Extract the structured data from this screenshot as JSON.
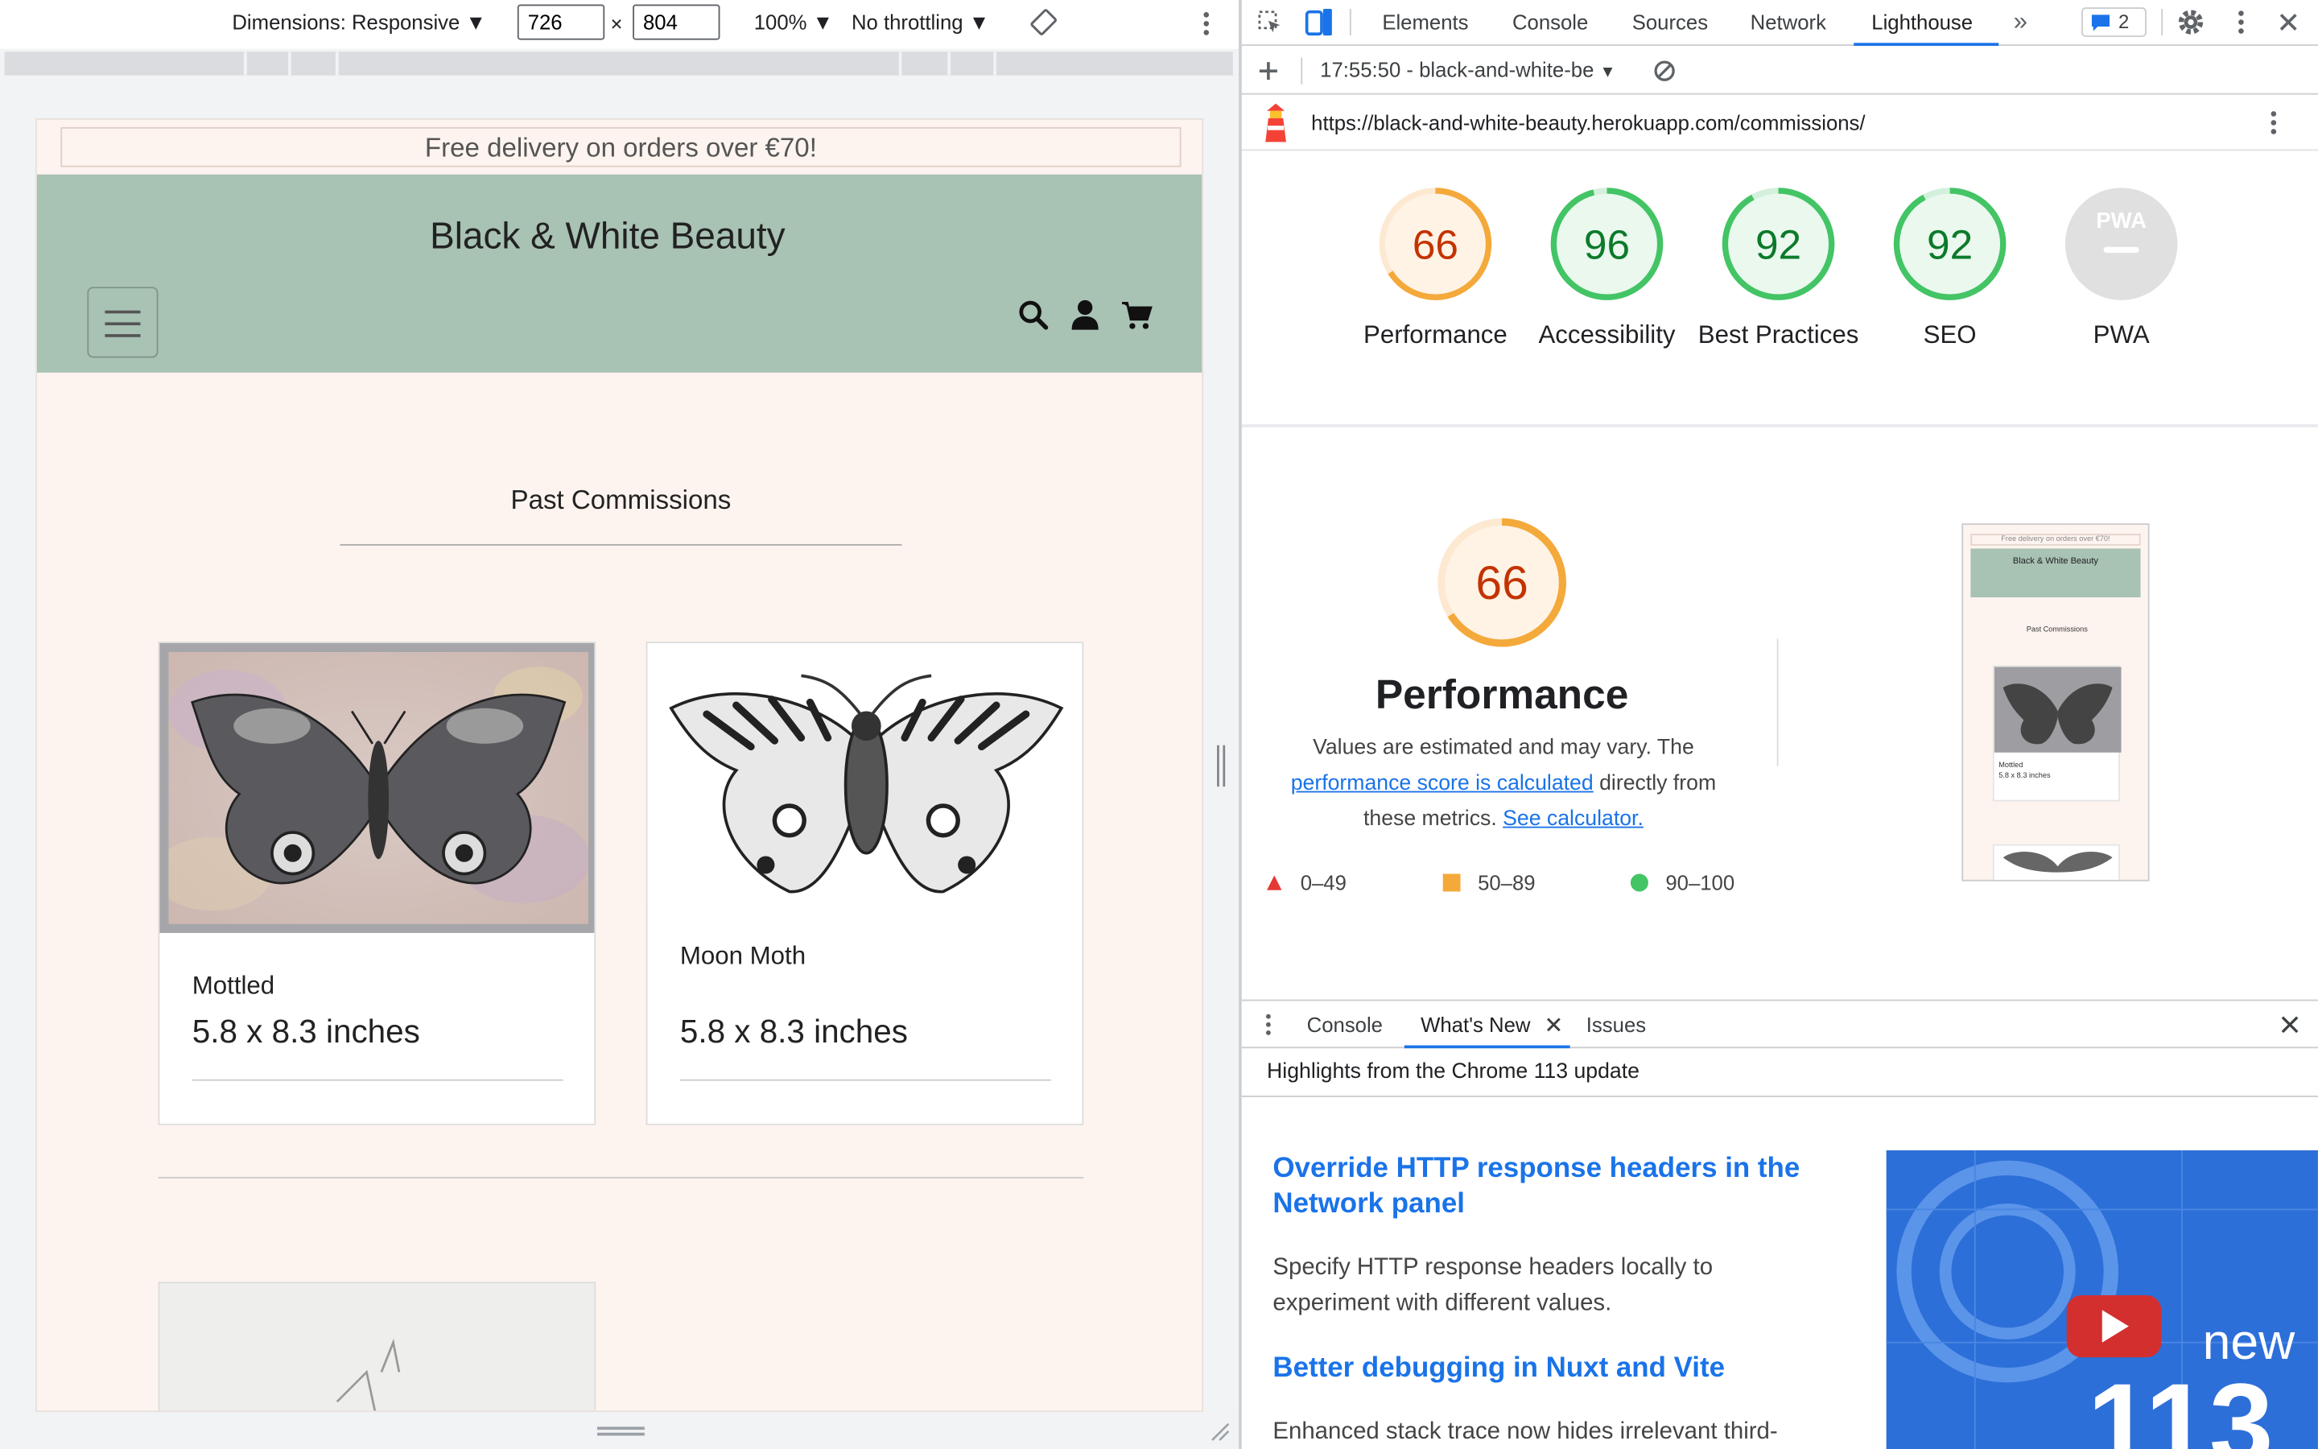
{
  "device_toolbar": {
    "dimensions_label": "Dimensions: Responsive",
    "width": "726",
    "times": "×",
    "height": "804",
    "zoom": "100%",
    "throttling": "No throttling"
  },
  "site": {
    "banner": "Free delivery on orders over €70!",
    "title": "Black & White Beauty",
    "section_title": "Past Commissions",
    "cards": [
      {
        "name": "Mottled",
        "size": "5.8 x 8.3 inches"
      },
      {
        "name": "Moon Moth",
        "size": "5.8 x 8.3 inches"
      }
    ]
  },
  "devtools": {
    "tabs": [
      "Elements",
      "Console",
      "Sources",
      "Network",
      "Lighthouse"
    ],
    "active_tab": "Lighthouse",
    "more_tabs": "»",
    "issues_count": "2",
    "report_label": "17:55:50 - black-and-white-be",
    "url": "https://black-and-white-beauty.herokuapp.com/commissions/",
    "scores": [
      {
        "label": "Performance",
        "value": 66,
        "color": "#e67700"
      },
      {
        "label": "Accessibility",
        "value": 96,
        "color": "#0c8c2c"
      },
      {
        "label": "Best Practices",
        "value": 92,
        "color": "#0c8c2c"
      },
      {
        "label": "SEO",
        "value": 92,
        "color": "#0c8c2c"
      },
      {
        "label": "PWA",
        "value": null,
        "color": "#bdbdbd"
      }
    ],
    "pwa_badge": "PWA",
    "performance": {
      "score": "66",
      "title": "Performance",
      "desc_1": "Values are estimated and may vary. The",
      "link_1": "performance score is calculated",
      "desc_2": "directly from these metrics.",
      "link_2": "See calculator."
    },
    "legend": [
      {
        "range": "0–49",
        "color": "#e53935"
      },
      {
        "range": "50–89",
        "color": "#f4a93b"
      },
      {
        "range": "90–100",
        "color": "#43c465"
      }
    ],
    "thumbnail": {
      "banner": "Free delivery on orders over €70!",
      "title": "Black & White Beauty",
      "section": "Past Commissions",
      "card_name": "Mottled",
      "card_size": "5.8 x 8.3 inches"
    }
  },
  "drawer": {
    "tabs": [
      "Console",
      "What's New",
      "Issues"
    ],
    "active_tab": "What's New",
    "highlights": "Highlights from the Chrome 113 update",
    "items": [
      {
        "title": "Override HTTP response headers in the Network panel",
        "body": "Specify HTTP response headers locally to experiment with different values."
      },
      {
        "title": "Better debugging in Nuxt and Vite",
        "body": "Enhanced stack trace now hides irrelevant third-"
      }
    ],
    "video_new": "new",
    "video_version": "113"
  },
  "colors": {
    "accent": "#1a73e8",
    "header_green": "#a8c2b4",
    "page_bg": "#fdf4ef"
  }
}
